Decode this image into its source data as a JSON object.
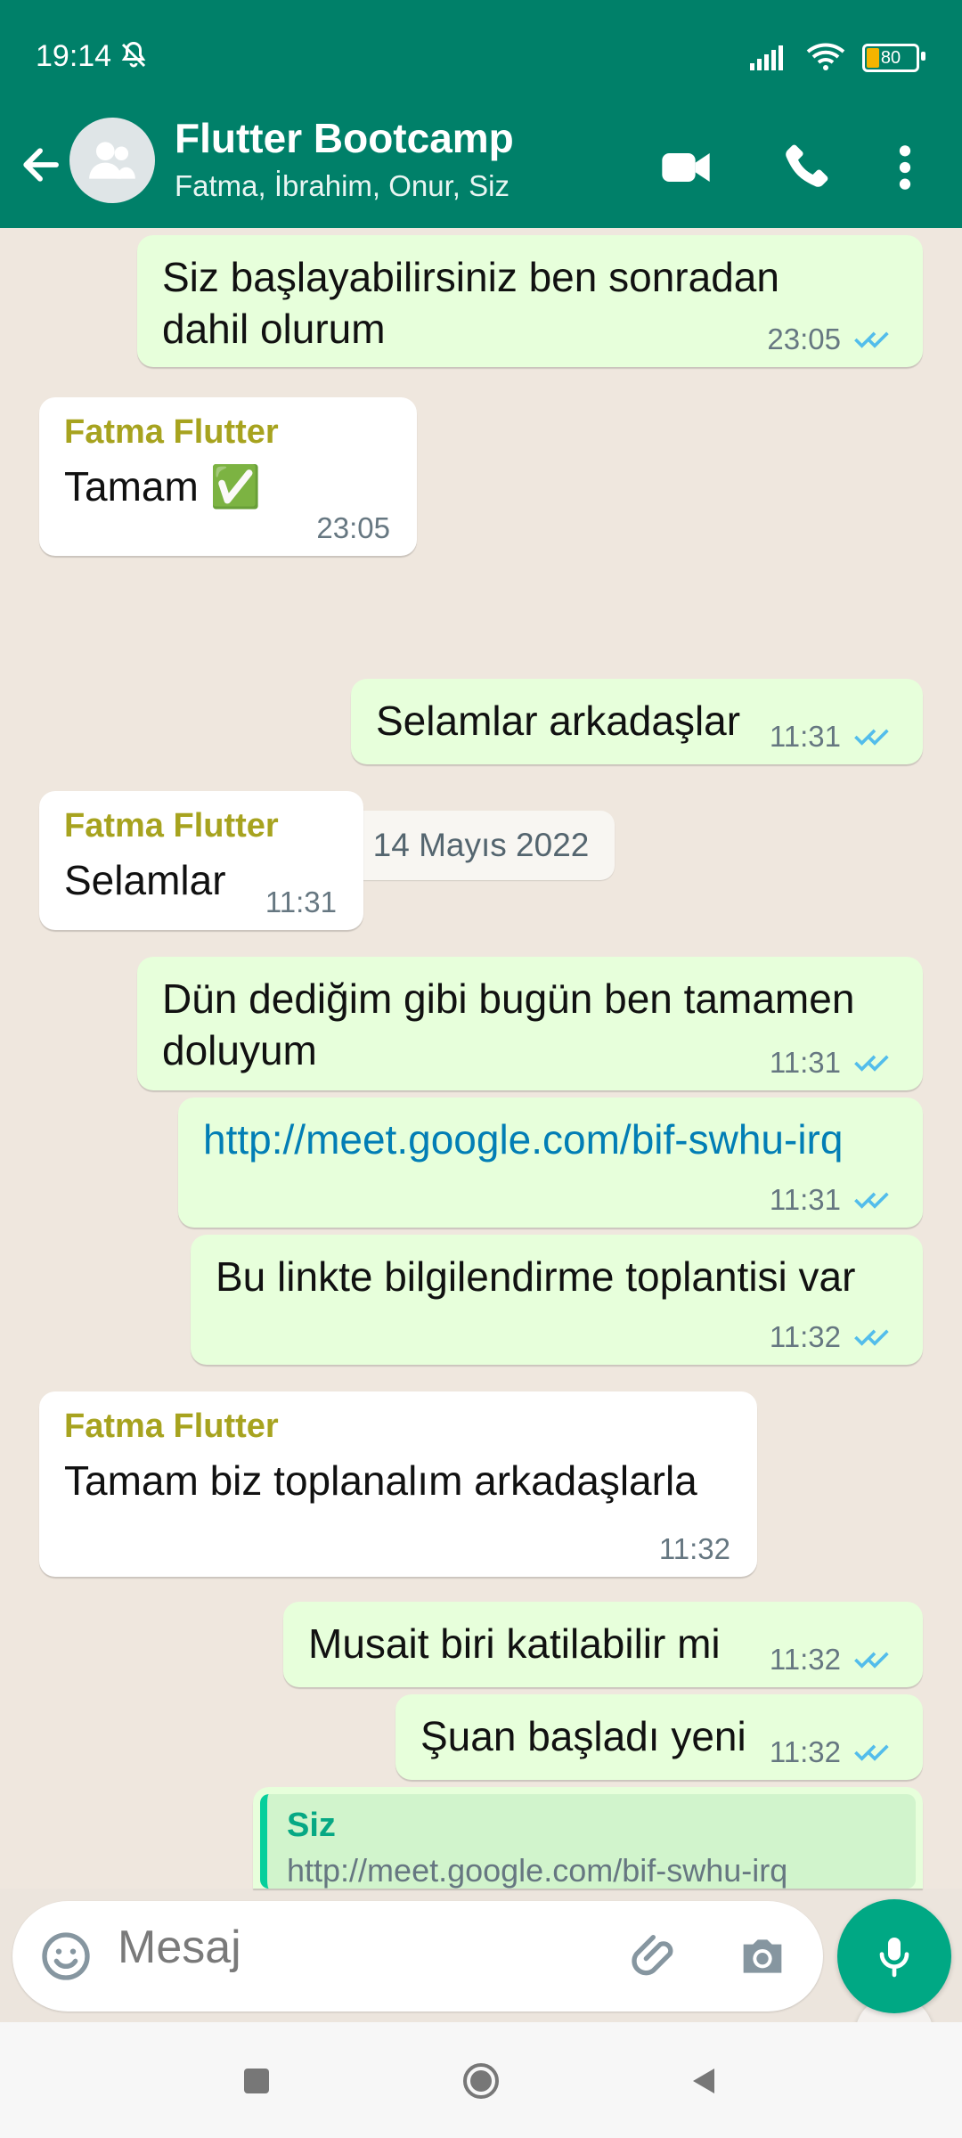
{
  "status": {
    "time": "19:14",
    "battery": "80"
  },
  "header": {
    "title": "Flutter Bootcamp",
    "subtitle": "Fatma, İbrahim, Onur, Siz"
  },
  "chat": {
    "date_chip": "14 Mayıs 2022",
    "messages": [
      {
        "type": "out",
        "text": "Siz başlayabilirsiniz ben sonradan dahil olurum",
        "time": "23:05"
      },
      {
        "type": "in",
        "sender": "Fatma Flutter",
        "text": "Tamam ✅",
        "time": "23:05"
      },
      {
        "type": "out",
        "text": "Selamlar arkadaşlar",
        "time": "11:31"
      },
      {
        "type": "in",
        "sender": "Fatma Flutter",
        "text": "Selamlar",
        "time": "11:31"
      },
      {
        "type": "out",
        "text": "Dün dediğim gibi bugün ben tamamen doluyum",
        "time": "11:31"
      },
      {
        "type": "out",
        "text": "http://meet.google.com/bif-swhu-irq",
        "time": "11:31"
      },
      {
        "type": "out",
        "text": "Bu linkte bilgilendirme toplantisi var",
        "time": "11:32"
      },
      {
        "type": "in",
        "sender": "Fatma Flutter",
        "text": "Tamam biz toplanalım arkadaşlarla",
        "time": "11:32"
      },
      {
        "type": "out",
        "text": "Musait biri katilabilir mi",
        "time": "11:32"
      },
      {
        "type": "out",
        "text": "Şuan başladı yeni",
        "time": "11:32"
      },
      {
        "type": "out_reply",
        "sender": "Siz",
        "text": "http://meet.google.com/bif-swhu-irq"
      }
    ]
  },
  "composer": {
    "placeholder": "Mesaj"
  },
  "colors": {
    "accent": "#008069",
    "outgoing_bubble": "#e7ffdb",
    "incoming_bubble": "#ffffff",
    "mic_button": "#00a884"
  },
  "icons": [
    "back-arrow-icon",
    "group-icon",
    "video-call-icon",
    "phone-icon",
    "more-icon",
    "emoji-icon",
    "attachment-icon",
    "camera-icon",
    "microphone-icon",
    "scroll-down-icon",
    "read-ticks-icon"
  ]
}
